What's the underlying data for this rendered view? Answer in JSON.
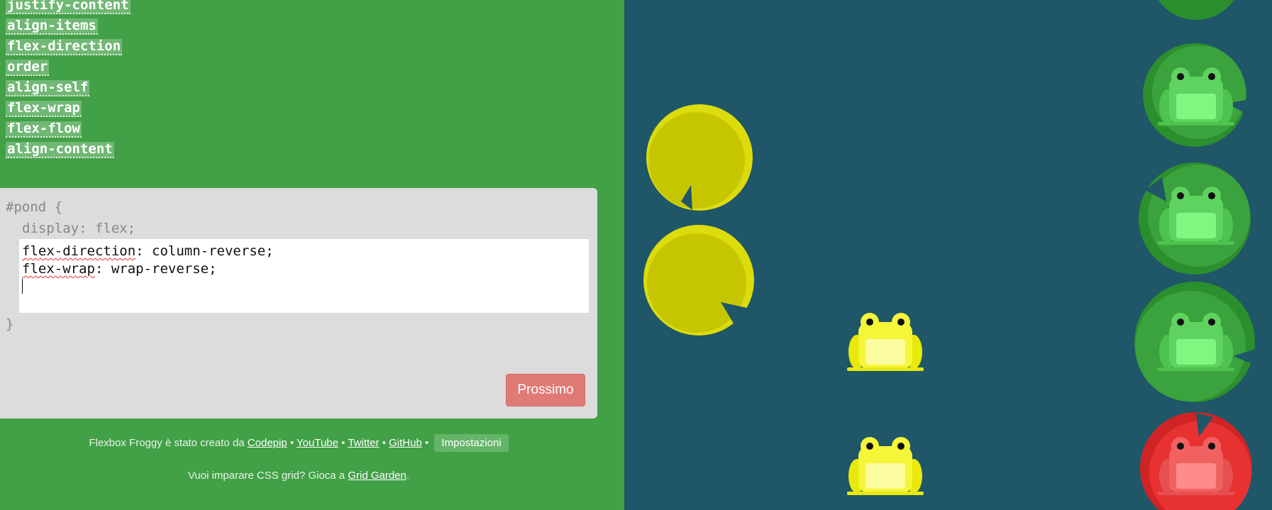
{
  "properties": [
    "justify-content",
    "align-items",
    "flex-direction",
    "order",
    "align-self",
    "flex-wrap",
    "flex-flow",
    "align-content"
  ],
  "editor": {
    "open_line": "#pond {",
    "display_line": "display: flex;",
    "input_line1_prop": "flex-direction",
    "input_line1_value": "column-reverse;",
    "input_line2_prop": "flex-wrap",
    "input_line2_value": "wrap-reverse;",
    "close_line": "}",
    "next_button": "Prossimo"
  },
  "footer": {
    "line1_prefix": "Flexbox Froggy è stato creato da",
    "link_codepip": "Codepip",
    "link_youtube": "YouTube",
    "link_twitter": "Twitter",
    "link_github": "GitHub",
    "separator": "•",
    "settings_button": "Impostazioni",
    "line2_prefix": "Vuoi imparare CSS grid? Gioca a",
    "link_grid_garden": "Grid Garden",
    "line2_suffix": "."
  },
  "colors": {
    "left_bg": "#42a047",
    "pond_bg": "#1f5668",
    "lily_yellow": "#c6c600",
    "lily_green": "#2b8f2e",
    "lily_red": "#d02424",
    "frog_yellow": "#f5f53a",
    "frog_green": "#5fd35f",
    "frog_red": "#f26161"
  }
}
